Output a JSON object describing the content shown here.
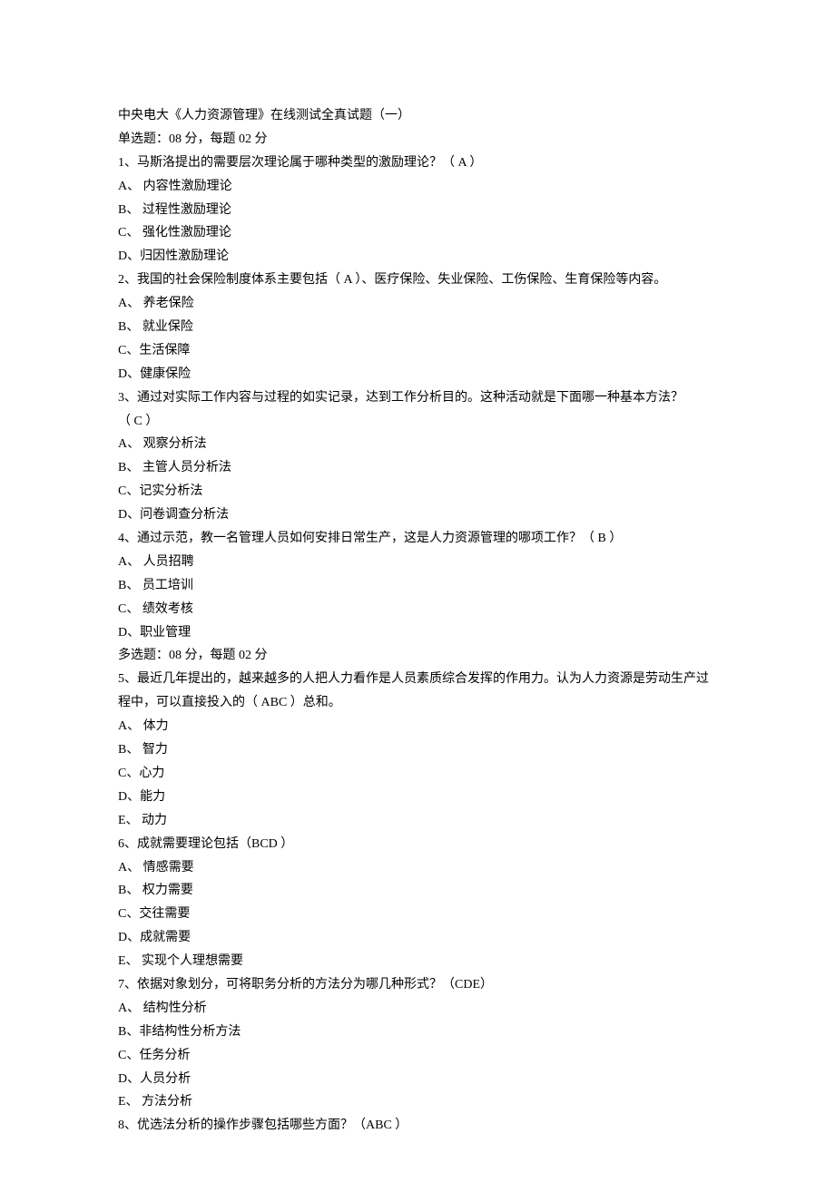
{
  "title": "中央电大《人力资源管理》在线测试全真试题（一）",
  "section_single": "单选题：08 分，每题 02 分",
  "q1": {
    "stem": "1、马斯洛提出的需要层次理论属于哪种类型的激励理论？（ A ）",
    "a": "A、 内容性激励理论",
    "b": "B、 过程性激励理论",
    "c": "C、 强化性激励理论",
    "d": "D、归因性激励理论"
  },
  "q2": {
    "stem": "2、我国的社会保险制度体系主要包括（ A ）、医疗保险、失业保险、工伤保险、生育保险等内容。",
    "a": "A、 养老保险",
    "b": "B、 就业保险",
    "c": "C、生活保障",
    "d": "D、健康保险"
  },
  "q3": {
    "stem1": "3、通过对实际工作内容与过程的如实记录，达到工作分析目的。这种活动就是下面哪一种基本方法？",
    "stem2": "（ C ）",
    "a": "A、 观察分析法",
    "b": "B、 主管人员分析法",
    "c": "C、记实分析法",
    "d": "D、问卷调查分析法"
  },
  "q4": {
    "stem": "4、通过示范，教一名管理人员如何安排日常生产，这是人力资源管理的哪项工作？（ B ）",
    "a": "A、 人员招聘",
    "b": "B、 员工培训",
    "c": "C、 绩效考核",
    "d": "D、职业管理"
  },
  "section_multi": "多选题：08 分，每题 02 分",
  "q5": {
    "stem1": "5、最近几年提出的，越来越多的人把人力看作是人员素质综合发挥的作用力。认为人力资源是劳动生产过",
    "stem2": "程中，可以直接投入的（ ABC ）总和。",
    "a": "A、 体力",
    "b": "B、 智力",
    "c": "C、心力",
    "d": "D、能力",
    "e": "E、 动力"
  },
  "q6": {
    "stem": "6、成就需要理论包括（BCD ）",
    "a": "A、 情感需要",
    "b": "B、 权力需要",
    "c": "C、交往需要",
    "d": "D、成就需要",
    "e": "E、 实现个人理想需要"
  },
  "q7": {
    "stem": "7、依据对象划分，可将职务分析的方法分为哪几种形式？（CDE）",
    "a": "A、 结构性分析",
    "b": "B、非结构性分析方法",
    "c": "C、任务分析",
    "d": "D、人员分析",
    "e": "E、 方法分析"
  },
  "q8": {
    "stem": "8、优选法分析的操作步骤包括哪些方面？（ABC ）"
  }
}
